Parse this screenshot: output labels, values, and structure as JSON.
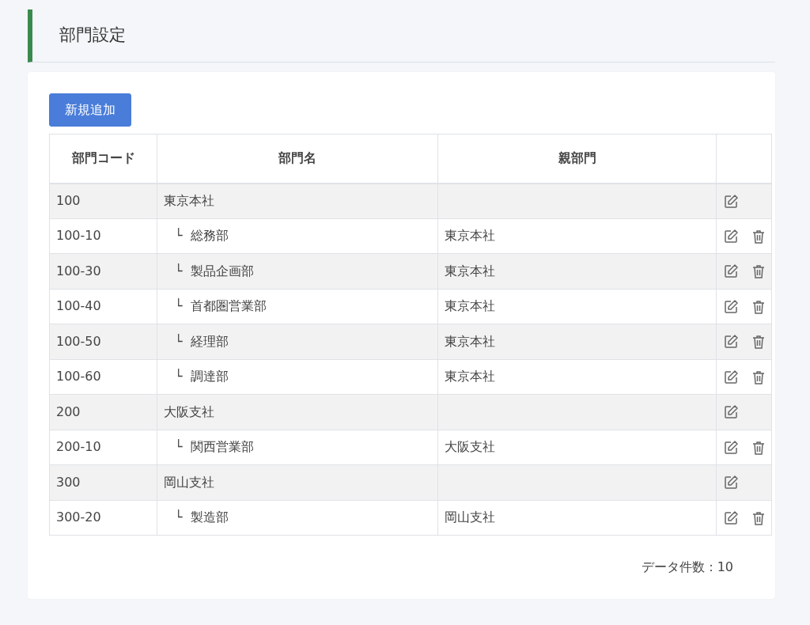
{
  "page_title": "部門設定",
  "add_button": "新規追加",
  "table": {
    "columns": [
      "部門コード",
      "部門名",
      "親部門"
    ],
    "rows": [
      {
        "code": "100",
        "name": "東京本社",
        "deletable": false,
        "children": [
          {
            "code": "100-10",
            "marker": "└",
            "name": "総務部",
            "parent": "東京本社",
            "deletable": true
          },
          {
            "code": "100-30",
            "marker": "└",
            "name": "製品企画部",
            "parent": "東京本社",
            "deletable": true
          },
          {
            "code": "100-40",
            "marker": "└",
            "name": "首都圏営業部",
            "parent": "東京本社",
            "deletable": true
          },
          {
            "code": "100-50",
            "marker": "└",
            "name": "経理部",
            "parent": "東京本社",
            "deletable": true
          },
          {
            "code": "100-60",
            "marker": "└",
            "name": "調達部",
            "parent": "東京本社",
            "deletable": true
          }
        ]
      },
      {
        "code": "200",
        "name": "大阪支社",
        "deletable": false,
        "children": [
          {
            "code": "200-10",
            "marker": "└",
            "name": "関西営業部",
            "parent": "大阪支社",
            "deletable": true
          }
        ]
      },
      {
        "code": "300",
        "name": "岡山支社",
        "deletable": false,
        "children": [
          {
            "code": "300-20",
            "marker": "└",
            "name": "製造部",
            "parent": "岡山支社",
            "deletable": true
          }
        ]
      }
    ]
  },
  "record_count": "データ件数：10"
}
